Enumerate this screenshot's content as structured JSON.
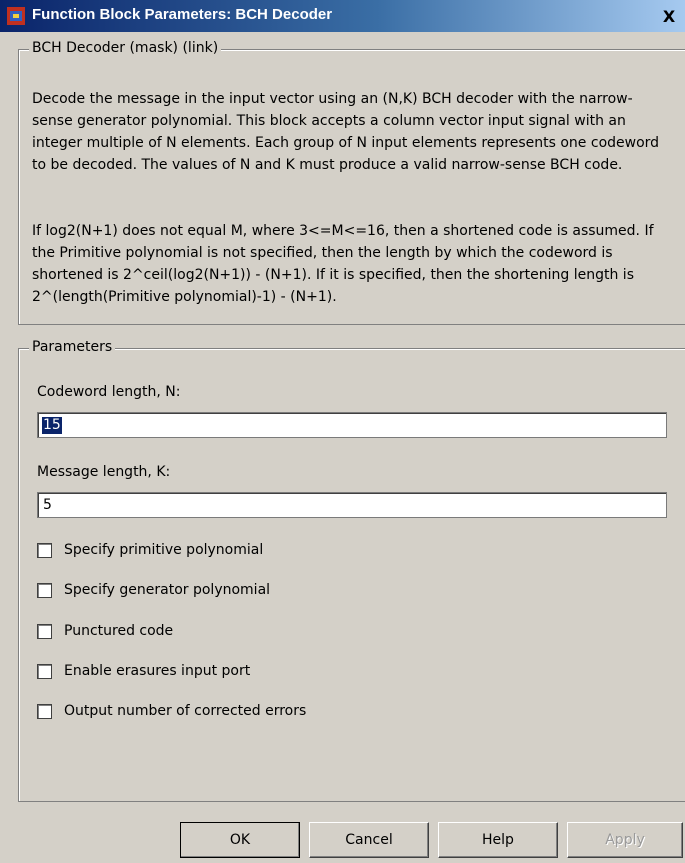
{
  "window": {
    "title": "Function Block Parameters: BCH Decoder",
    "close_glyph": "X"
  },
  "mask_group": {
    "legend": "BCH Decoder (mask) (link)",
    "paragraph1": "Decode the message in the input vector using an (N,K) BCH decoder with the narrow-sense generator polynomial.  This block accepts a column vector input signal with an integer multiple of N elements.  Each group of N input elements represents one codeword to be decoded.  The values of N and K must produce a valid narrow-sense BCH code.",
    "paragraph2": "If log2(N+1) does not equal M, where 3<=M<=16, then a shortened code is assumed.  If the Primitive polynomial is not specified, then the length by which the codeword is shortened is 2^ceil(log2(N+1)) - (N+1).  If it is specified, then the shortening length is 2^(length(Primitive polynomial)-1) - (N+1)."
  },
  "parameters": {
    "legend": "Parameters",
    "codeword_label": "Codeword length, N:",
    "codeword_value": "15",
    "message_label": "Message length, K:",
    "message_value": "5",
    "checkboxes": [
      {
        "label": "Specify primitive polynomial",
        "checked": false
      },
      {
        "label": "Specify generator polynomial",
        "checked": false
      },
      {
        "label": "Punctured code",
        "checked": false
      },
      {
        "label": "Enable erasures input port",
        "checked": false
      },
      {
        "label": "Output number of corrected errors",
        "checked": false
      }
    ]
  },
  "buttons": {
    "ok": "OK",
    "cancel": "Cancel",
    "help": "Help",
    "apply": "Apply"
  }
}
